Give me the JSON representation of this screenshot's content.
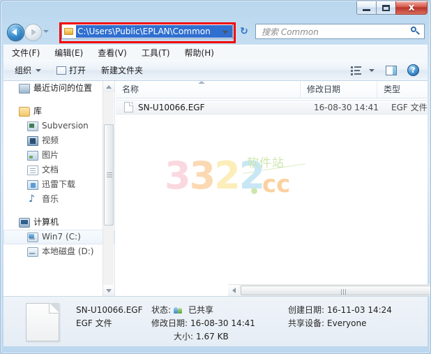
{
  "window": {
    "controls": {
      "minimize": "–",
      "maximize": "□",
      "close": "x"
    }
  },
  "nav": {
    "back_icon": "back-arrow",
    "forward_icon": "forward-arrow",
    "recent_dropdown_icon": "chevron-down",
    "address_value": "C:\\Users\\Public\\EPLAN\\Common",
    "address_dropdown_icon": "chevron-down",
    "refresh_icon": "↻",
    "search_placeholder": "搜索 Common",
    "search_icon": "magnifier"
  },
  "menubar": {
    "items": [
      {
        "label": "文件(F)"
      },
      {
        "label": "编辑(E)"
      },
      {
        "label": "查看(V)"
      },
      {
        "label": "工具(T)"
      },
      {
        "label": "帮助(H)"
      }
    ]
  },
  "toolbar": {
    "organize_label": "组织",
    "open_label": "打开",
    "new_folder_label": "新建文件夹",
    "view_icon": "list-view-icon",
    "preview_pane_icon": "preview-pane-icon",
    "help_label": "?"
  },
  "sidebar": {
    "items": [
      {
        "label": "最近访问的位置",
        "icon": "recent-places-icon",
        "level": 0
      },
      {
        "label": "库",
        "icon": "library-icon",
        "level": 0
      },
      {
        "label": "Subversion",
        "icon": "subversion-icon",
        "level": 1
      },
      {
        "label": "视频",
        "icon": "videos-icon",
        "level": 1
      },
      {
        "label": "图片",
        "icon": "pictures-icon",
        "level": 1
      },
      {
        "label": "文档",
        "icon": "documents-icon",
        "level": 1
      },
      {
        "label": "迅雷下载",
        "icon": "thunder-download-icon",
        "level": 1
      },
      {
        "label": "音乐",
        "icon": "music-icon",
        "level": 1
      },
      {
        "label": "计算机",
        "icon": "computer-icon",
        "level": 0
      },
      {
        "label": "Win7 (C:)",
        "icon": "drive-c-icon",
        "level": 1,
        "selected": true
      },
      {
        "label": "本地磁盘 (D:)",
        "icon": "drive-d-icon",
        "level": 1
      }
    ]
  },
  "filelist": {
    "columns": [
      {
        "label": "名称"
      },
      {
        "label": "修改日期"
      },
      {
        "label": "类型"
      }
    ],
    "sort_indicator": "ascending",
    "rows": [
      {
        "name": "SN-U10066.EGF",
        "modified": "16-08-30 14:41",
        "type": "EGF 文件",
        "icon": "generic-file-icon",
        "selected": true
      }
    ]
  },
  "watermark": {
    "digits": [
      {
        "char": "3",
        "color": "#f4a3b4"
      },
      {
        "char": "3",
        "color": "#f7a64b"
      },
      {
        "char": "2",
        "color": "#f9d55a"
      },
      {
        "char": "2",
        "color": "#7ec8e8"
      }
    ],
    "suffix": "cc",
    "cn_text": "软件站"
  },
  "details": {
    "file_name": "SN-U10066.EGF",
    "file_type": "EGF 文件",
    "status_key": "状态:",
    "status_value": "已共享",
    "status_icon": "shared-users-icon",
    "modified_key": "修改日期:",
    "modified_value": "16-08-30 14:41",
    "size_key": "大小:",
    "size_value": "1.67 KB",
    "created_key": "创建日期:",
    "created_value": "16-11-03 14:24",
    "shared_with_key": "共享设备:",
    "shared_with_value": "Everyone"
  }
}
